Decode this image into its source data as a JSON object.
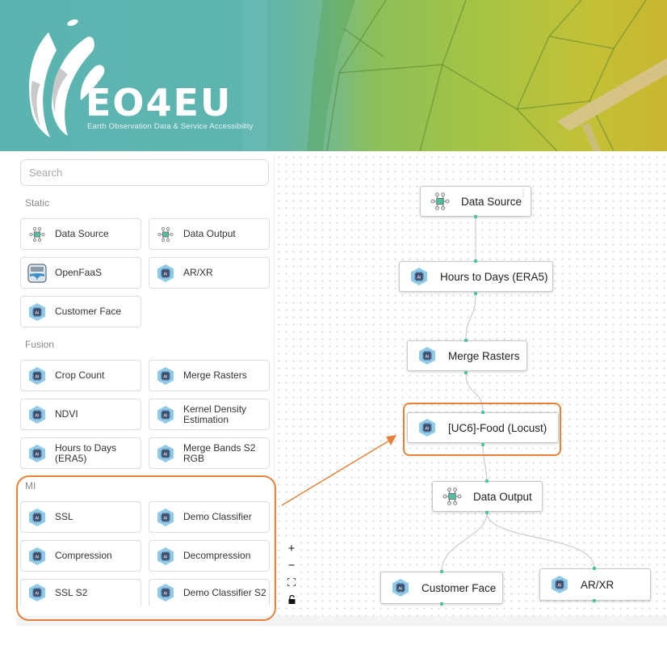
{
  "banner": {
    "brand": "EO4EU",
    "tagline": "Earth Observation Data & Service Accessibility"
  },
  "sidebar": {
    "search": {
      "placeholder": "Search",
      "value": ""
    },
    "sections": [
      {
        "label": "Static",
        "items": [
          {
            "label": "Data Source",
            "icon": "network-nodes-icon"
          },
          {
            "label": "Data Output",
            "icon": "network-nodes-icon"
          },
          {
            "label": "OpenFaaS",
            "icon": "openfaas-whale-icon"
          },
          {
            "label": "AR/XR",
            "icon": "ai-chip-icon"
          },
          {
            "label": "Customer Face",
            "icon": "ai-chip-icon"
          }
        ]
      },
      {
        "label": "Fusion",
        "items": [
          {
            "label": "Crop Count",
            "icon": "ai-chip-icon"
          },
          {
            "label": "Merge Rasters",
            "icon": "ai-chip-icon"
          },
          {
            "label": "NDVI",
            "icon": "ai-chip-icon"
          },
          {
            "label": "Kernel Density Estimation",
            "icon": "ai-chip-icon"
          },
          {
            "label": "Hours to Days (ERA5)",
            "icon": "ai-chip-icon"
          },
          {
            "label": "Merge Bands S2 RGB",
            "icon": "ai-chip-icon"
          }
        ]
      },
      {
        "label": "MI",
        "items": [
          {
            "label": "SSL",
            "icon": "ai-chip-icon"
          },
          {
            "label": "Demo Classifier",
            "icon": "ai-chip-icon"
          },
          {
            "label": "Compression",
            "icon": "ai-chip-icon"
          },
          {
            "label": "Decompression",
            "icon": "ai-chip-icon"
          },
          {
            "label": "SSL S2",
            "icon": "ai-chip-icon"
          },
          {
            "label": "Demo Classifier S2",
            "icon": "ai-chip-icon"
          }
        ]
      }
    ]
  },
  "canvas": {
    "nodes": [
      {
        "label": "Data Source",
        "icon": "network-nodes-icon"
      },
      {
        "label": "Hours to Days (ERA5)",
        "icon": "ai-chip-icon"
      },
      {
        "label": "Merge Rasters",
        "icon": "ai-chip-icon"
      },
      {
        "label": "[UC6]-Food (Locust)",
        "icon": "ai-chip-icon"
      },
      {
        "label": "Data Output",
        "icon": "network-nodes-icon"
      },
      {
        "label": "Customer Face",
        "icon": "ai-chip-icon"
      },
      {
        "label": "AR/XR",
        "icon": "ai-chip-icon"
      }
    ],
    "node_menu_glyph": "⋮",
    "controls": {
      "zoom_in": "+",
      "zoom_out": "−",
      "fit_view": "⛶",
      "lock": "🔓"
    }
  },
  "colors": {
    "highlight": "#e8823a",
    "handle": "#4cc3a3",
    "ai_icon_fill": "#8fcbe8",
    "ai_chip": "#3b4a6b",
    "banner_teal": "#5cb4b1"
  }
}
